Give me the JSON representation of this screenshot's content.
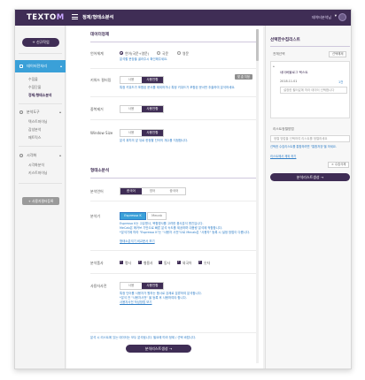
{
  "colors": {
    "brand": "#3f2d55",
    "accent": "#3aa0d8",
    "link": "#2f7ec7"
  },
  "topbar": {
    "logo_main": "TEXTO",
    "logo_accent": "M",
    "title": "정제/형태소분석",
    "user": "데이터분석님"
  },
  "sidebar": {
    "new_button": "+ 신규작업",
    "active_item": "데이터전처리",
    "sub_items": [
      "수집물",
      "수집단물",
      "정제/형태소분석"
    ],
    "groups": [
      "분석도구",
      "시각화"
    ],
    "analysis_items": [
      "텍스트마이닝",
      "감성분석",
      "매트릭스"
    ],
    "visual_items": [
      "시각화분석",
      "키스트마이닝"
    ],
    "custom_button": "+ 사용자필터등록"
  },
  "main": {
    "refine_title": "데이터정제",
    "language_label": "언어체계",
    "language_options": [
      "언어(국문+영문)",
      "국문",
      "영문"
    ],
    "language_note": "분석할 문장을 골라주시 확인해주세요.",
    "keyword_label": "키워드 필터링",
    "keyword_off": "사용",
    "keyword_on": "사용안함",
    "keyword_tag": "맞 춘 지정",
    "keyword_note": "특정 키워드가 포함된 문서를 제외하거나 특정 키워드가 포함된 문서만 추출하여 분석하세요.",
    "dedupe_label": "중복제거",
    "dedupe_off": "사용",
    "dedupe_on": "사용안함",
    "window_label": "Window Size",
    "window_off": "사용",
    "window_on": "사용안함",
    "window_note": "분석 위치의 앞 뒤로 한정할 단어의 개수를 지정합니다.",
    "morph_title": "형태소분석",
    "morph_lang_label": "분석언어",
    "morph_lang_options": [
      "한국어",
      "영어",
      "중국어"
    ],
    "analyzer_label": "분석기",
    "analyzer_options": [
      "Espresso K",
      "Mecab"
    ],
    "analyzer_note_1": "Espresso K는 고유명사, 복합명사를 고려한 품사분석 엔진입니다.",
    "analyzer_note_2": "MeCab은 메카브 기반으로 빠른 분석 속도를 제공하며 대용량 분석에 적합합니다.",
    "analyzer_note_3": "*분석기에 따라 \"Espresso K\"는 \"사용자 사전\"으로 Mecab은 \"사용자\" 등록 시 설정 방법이 다릅니다.",
    "analyzer_link": "형태소분석기 비교문서 보기",
    "pos_label": "분석품사",
    "pos_options": [
      "명사",
      "형용사",
      "동사",
      "외국어",
      "숫자"
    ],
    "userdict_label": "사용자사전",
    "userdict_off": "사용",
    "userdict_on": "사용안함",
    "userdict_note_1": "특정 단어를 사용자가 원하는 품사로 강제로 분류하여 분석합니다.",
    "userdict_note_2": "*분석 전 \"사용자사전\" 을 등록 후 사용하여야 합니다.",
    "userdict_link": "사용자사전 작성방법 보기",
    "footer_note": "분석 시 리스트에 있는 데이터는 모두 분석됩니다. 필요에 따라 정제 / 선택 바랍니다.",
    "run_button": "분석리스트생성 →"
  },
  "right": {
    "title": "선택한수집리스트",
    "all_label": "전체선택",
    "select_all": "선택해제",
    "dataset_name": "네이버블로그 텍스트",
    "date": "2018.11.01",
    "count": "1건",
    "search_placeholder": "설정한 필터값에 따라 데이터 선택합니다",
    "filter_label": "리스트정렬방법",
    "filter_placeholder": "정렬 방법을 선택하여 리스트를 정렬하세요",
    "info_text": "선택한 수집리스트를 통합하려면 \"통합저장\"을 하세요.",
    "info_link": "리스트에서 제외 하기",
    "delete_button": "× 수집삭제",
    "run_button": "분석리스트생성 →"
  }
}
